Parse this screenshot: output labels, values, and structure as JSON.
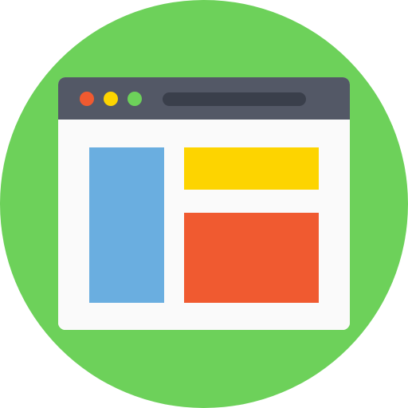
{
  "colors": {
    "background_circle": "#6dd15a",
    "window_frame": "#535866",
    "window_content": "#fafafa",
    "address_bar": "#3a3f4b",
    "dot_red": "#f05a30",
    "dot_yellow": "#fdd400",
    "dot_green": "#6dd15a",
    "sidebar_block": "#6aaee0",
    "banner_block": "#fdd400",
    "main_block": "#f05a30"
  },
  "icons": {
    "main": "browser-window-icon",
    "window_controls": [
      "close-dot-icon",
      "minimize-dot-icon",
      "maximize-dot-icon"
    ]
  }
}
